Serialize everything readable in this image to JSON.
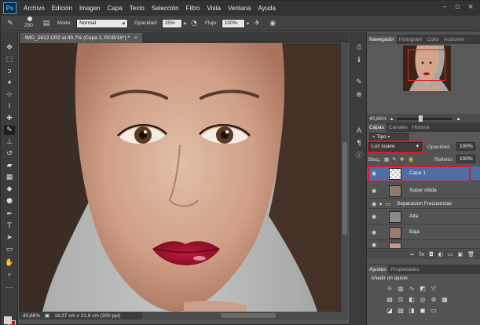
{
  "app": {
    "logo": "Ps",
    "menu": [
      "Archivo",
      "Edición",
      "Imagen",
      "Capa",
      "Texto",
      "Selección",
      "Filtro",
      "Vista",
      "Ventana",
      "Ayuda"
    ]
  },
  "options": {
    "brush_size": "250",
    "mode_label": "Modo:",
    "mode_value": "Normal",
    "opacity_label": "Opacidad:",
    "opacity_value": "25%",
    "flow_label": "Flujo:",
    "flow_value": "100%"
  },
  "document": {
    "tab_title": "IMG_5612.CR2 al 40,7% (Capa 1, RGB/16*) *",
    "close_glyph": "×",
    "status_zoom": "40,66%",
    "status_info": "18,97 cm x 21,6 cm (300 ppi)"
  },
  "navigator": {
    "tabs": [
      "Navegador",
      "Histogram",
      "Color",
      "Acciones"
    ],
    "zoom": "40,66%"
  },
  "layers_panel": {
    "tabs": [
      "Capas",
      "Canales",
      "Historia"
    ],
    "filter_value": "Tipo",
    "blend_mode": "Luz suave",
    "opacity_label": "Opacidad:",
    "opacity_value": "100%",
    "lock_label": "Bloq.:",
    "fill_label": "Relleno:",
    "fill_value": "100%",
    "layers": [
      {
        "name": "Capa 1",
        "selected": true
      },
      {
        "name": "Super nitida",
        "selected": false
      },
      {
        "name": "Separacion Frecuencias",
        "selected": false
      },
      {
        "name": "Alta",
        "selected": false
      },
      {
        "name": "Baja",
        "selected": false
      },
      {
        "name": "",
        "selected": false
      }
    ]
  },
  "adjustments": {
    "tabs": [
      "Ajustes",
      "Propiedades"
    ],
    "subtitle": "Añadir un ajuste"
  },
  "colors": {
    "highlight_red": "#e0162b",
    "selected_layer": "#4d6fa3",
    "foreground": "#e8cfc6",
    "background": "#c8102e"
  }
}
